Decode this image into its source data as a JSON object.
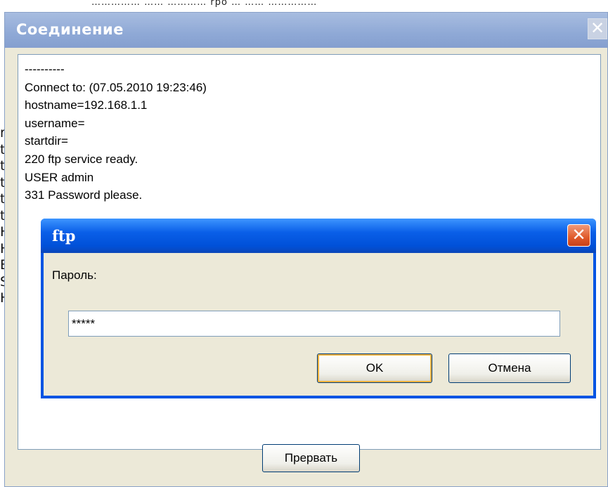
{
  "background": {
    "top_text": "…………… …… ………… rpo … …… ……………",
    "left_column": [
      "r",
      "t",
      "t",
      "t",
      "t",
      "t",
      "H",
      "H",
      "E",
      "S",
      "H"
    ]
  },
  "main_dialog": {
    "title": "Соединение",
    "close_glyph": "✕",
    "log_lines": [
      "----------",
      "Connect to: (07.05.2010 19:23:46)",
      "hostname=192.168.1.1",
      "username=",
      "startdir=",
      "220 ftp service ready.",
      "USER admin",
      "331 Password please."
    ],
    "abort_button": "Прервать"
  },
  "ftp_dialog": {
    "title": "ftp",
    "close_glyph": "✕",
    "password_label": "Пароль:",
    "password_value": "*****",
    "ok_button": "OK",
    "cancel_button": "Отмена"
  },
  "colors": {
    "xp_blue": "#0054e3",
    "dialog_face": "#ece9d8",
    "inactive_title": "#8fa9d6",
    "close_red": "#e05a2a"
  }
}
